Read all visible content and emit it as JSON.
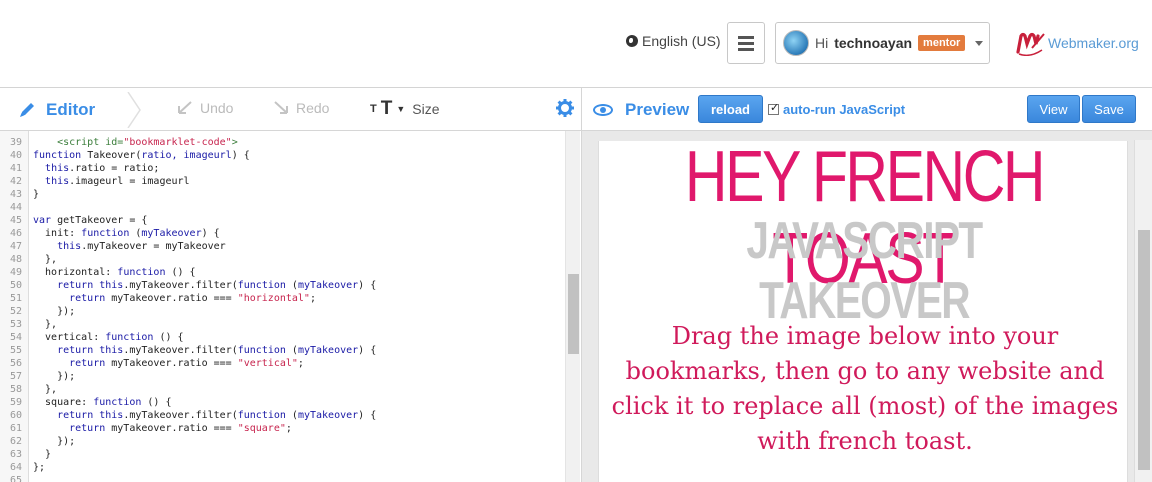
{
  "header": {
    "language": "English (US)",
    "greeting": "Hi",
    "username": "technoayan",
    "badge": "mentor",
    "brand": "Webmaker.org"
  },
  "toolbar": {
    "editor_label": "Editor",
    "undo_label": "Undo",
    "redo_label": "Redo",
    "size_label": "Size",
    "size_icon_small": "T",
    "size_icon_big": "T",
    "preview_label": "Preview",
    "reload_label": "reload",
    "autorun_label": "auto-run JavaScript",
    "autorun_checked": true,
    "view_label": "View",
    "save_label": "Save"
  },
  "editor": {
    "lines": [
      {
        "n": "39",
        "text": "    <script id=\"bookmarklet-code\">"
      },
      {
        "n": "40",
        "text": "function Takeover(ratio, imageurl) {"
      },
      {
        "n": "41",
        "text": "  this.ratio = ratio;"
      },
      {
        "n": "42",
        "text": "  this.imageurl = imageurl"
      },
      {
        "n": "43",
        "text": "}"
      },
      {
        "n": "44",
        "text": ""
      },
      {
        "n": "45",
        "text": "var getTakeover = {"
      },
      {
        "n": "46",
        "text": "  init: function (myTakeover) {"
      },
      {
        "n": "47",
        "text": "    this.myTakeover = myTakeover"
      },
      {
        "n": "48",
        "text": "  },"
      },
      {
        "n": "49",
        "text": "  horizontal: function () {"
      },
      {
        "n": "50",
        "text": "    return this.myTakeover.filter(function (myTakeover) {"
      },
      {
        "n": "51",
        "text": "      return myTakeover.ratio === \"horizontal\";"
      },
      {
        "n": "52",
        "text": "    });"
      },
      {
        "n": "53",
        "text": "  },"
      },
      {
        "n": "54",
        "text": "  vertical: function () {"
      },
      {
        "n": "55",
        "text": "    return this.myTakeover.filter(function (myTakeover) {"
      },
      {
        "n": "56",
        "text": "      return myTakeover.ratio === \"vertical\";"
      },
      {
        "n": "57",
        "text": "    });"
      },
      {
        "n": "58",
        "text": "  },"
      },
      {
        "n": "59",
        "text": "  square: function () {"
      },
      {
        "n": "60",
        "text": "    return this.myTakeover.filter(function (myTakeover) {"
      },
      {
        "n": "61",
        "text": "      return myTakeover.ratio === \"square\";"
      },
      {
        "n": "62",
        "text": "    });"
      },
      {
        "n": "63",
        "text": "  }"
      },
      {
        "n": "64",
        "text": "};"
      },
      {
        "n": "65",
        "text": ""
      }
    ]
  },
  "preview": {
    "heading": "HEY FRENCH TOAST",
    "subheading": "JAVASCRIPT TAKEOVER",
    "instructions": "Drag the image below into your bookmarks, then go to any website and click it to replace all (most) of the images with french toast."
  },
  "colors": {
    "accent_blue": "#3a8de6",
    "heading_pink": "#e0186c",
    "instruction_pink": "#d01a5b",
    "subheading_gray": "#c8c8c8",
    "mentor_orange": "#e37b3d"
  },
  "icons": {
    "language": "globe-icon",
    "menu": "hamburger-icon",
    "editor": "pencil-icon",
    "undo": "undo-arrow-icon",
    "redo": "redo-arrow-icon",
    "settings": "gear-icon",
    "preview": "eye-icon",
    "user_menu": "chevron-down-icon",
    "brand": "webmaker-logo-icon"
  }
}
